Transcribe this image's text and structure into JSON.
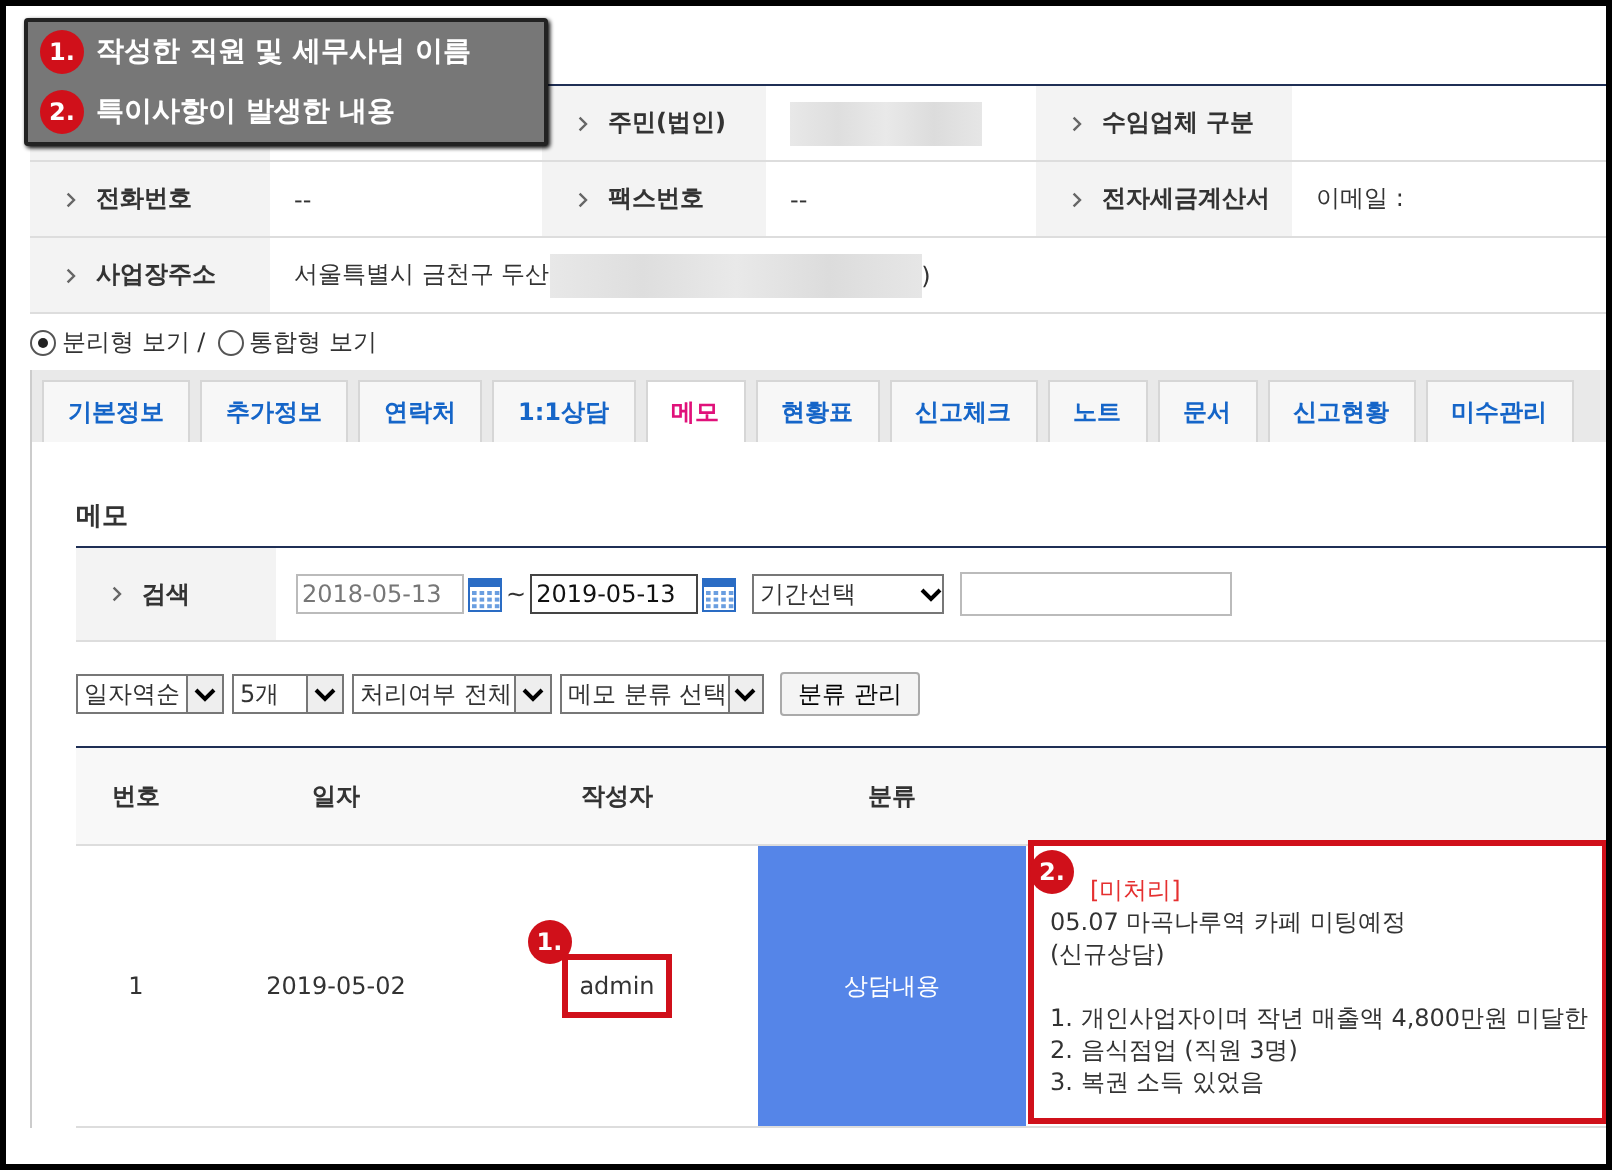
{
  "callout": {
    "items": [
      {
        "number": "1.",
        "text": "작성한 직원 및 세무사님 이름"
      },
      {
        "number": "2.",
        "text": "특이사항이 발생한 내용"
      }
    ]
  },
  "info_table": {
    "rows": [
      {
        "cells": [
          {
            "kind": "hidden"
          },
          {
            "kind": "field",
            "label": "주민(법인)",
            "redacted": true
          },
          {
            "kind": "field",
            "label": "수임업체 구분"
          }
        ]
      },
      {
        "cells": [
          {
            "kind": "field",
            "label": "전화번호",
            "value": "--"
          },
          {
            "kind": "field",
            "label": "팩스번호",
            "value": "--"
          },
          {
            "kind": "field",
            "label": "전자세금계산서",
            "value": "이메일 :"
          }
        ]
      },
      {
        "cells": [
          {
            "kind": "wide",
            "label": "사업장주소",
            "value": "서울특별시 금천구 두산",
            "redacted": true,
            "value_end": ")"
          }
        ]
      }
    ]
  },
  "view_options": [
    {
      "label": "분리형 보기 /",
      "selected": true
    },
    {
      "label": "통합형 보기",
      "selected": false
    }
  ],
  "tabs": [
    {
      "label": "기본정보",
      "selected": false
    },
    {
      "label": "추가정보",
      "selected": false
    },
    {
      "label": "연락처",
      "selected": false
    },
    {
      "label": "1:1상담",
      "selected": false
    },
    {
      "label": "메모",
      "selected": true
    },
    {
      "label": "현황표",
      "selected": false
    },
    {
      "label": "신고체크",
      "selected": false
    },
    {
      "label": "노트",
      "selected": false
    },
    {
      "label": "문서",
      "selected": false
    },
    {
      "label": "신고현황",
      "selected": false
    },
    {
      "label": "미수관리",
      "selected": false
    }
  ],
  "memo": {
    "title": "메모",
    "search": {
      "label": "검색",
      "date_from": "2018-05-13",
      "separator": "~",
      "date_to": "2019-05-13",
      "period": "기간선택"
    },
    "filters": [
      "일자역순",
      "5개",
      "처리여부 전체",
      "메모 분류 선택"
    ],
    "manage_button": "분류 관리",
    "table": {
      "columns": [
        "번호",
        "일자",
        "작성자",
        "분류"
      ],
      "rows": [
        {
          "no": "1",
          "date": "2019-05-02",
          "author": "admin",
          "author_badge": "1.",
          "category": "상담내용",
          "status": "[미처리]",
          "content_badge": "2.",
          "paragraphs": [
            [
              "05.07 마곡나루역 카페 미팅예정",
              "(신규상담)"
            ],
            [
              "1. 개인사업자이며 작년 매출액 4,800만원 미달한",
              "2. 음식점업 (직원 3명)",
              "3. 복권 소득 있었음"
            ]
          ]
        }
      ]
    }
  }
}
